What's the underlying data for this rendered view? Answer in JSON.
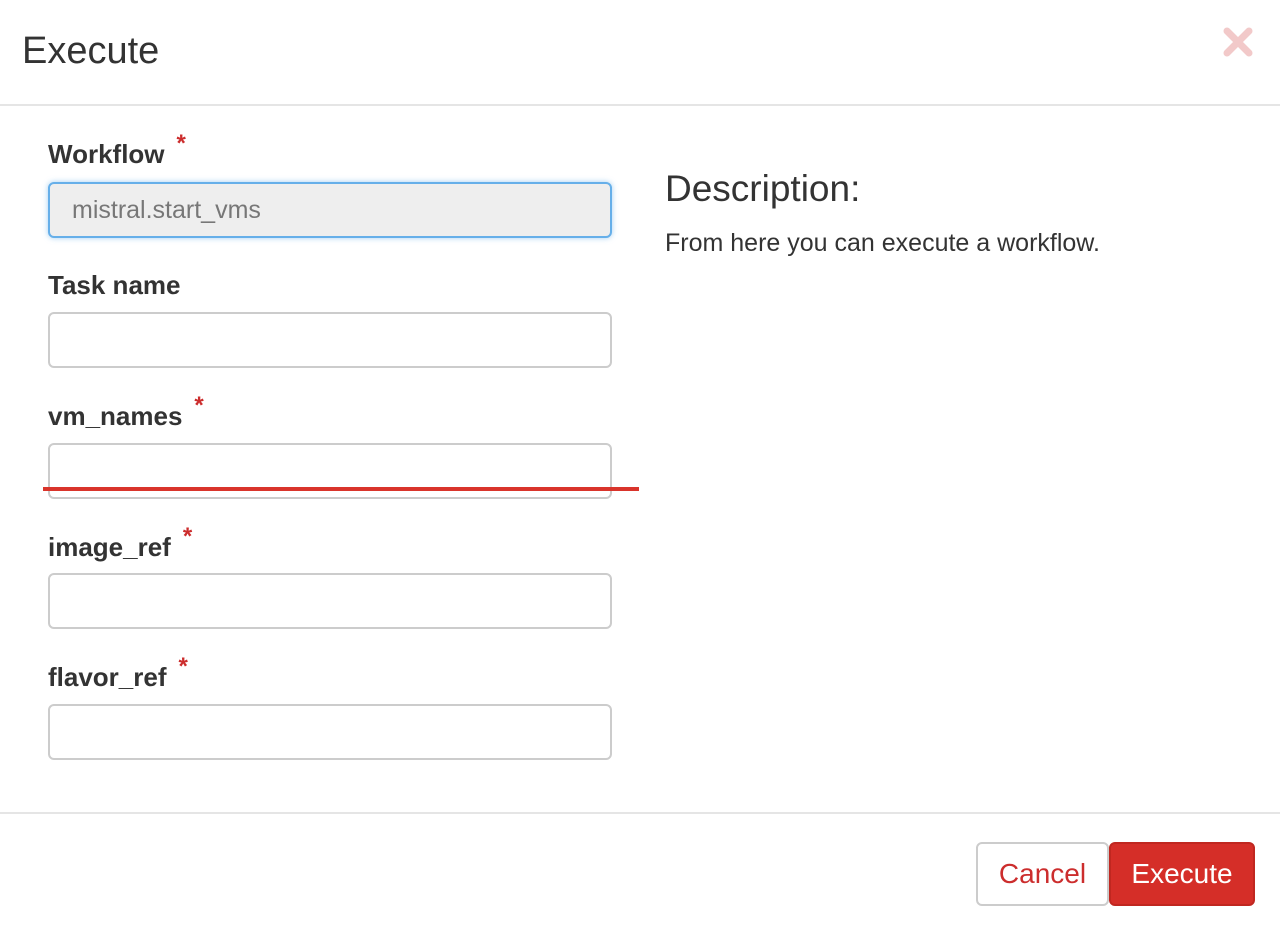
{
  "dialog": {
    "title": "Execute",
    "close_icon": "close-icon"
  },
  "form": {
    "workflow": {
      "label": "Workflow",
      "required_mark": "*",
      "value": "mistral.start_vms"
    },
    "task_name": {
      "label": "Task name",
      "value": ""
    },
    "vm_names": {
      "label": "vm_names",
      "required_mark": "*",
      "value": ""
    },
    "image_ref": {
      "label": "image_ref",
      "required_mark": "*",
      "value": ""
    },
    "flavor_ref": {
      "label": "flavor_ref",
      "required_mark": "*",
      "value": ""
    }
  },
  "description": {
    "title": "Description:",
    "text": "From here you can execute a workflow."
  },
  "footer": {
    "cancel_label": "Cancel",
    "execute_label": "Execute"
  },
  "colors": {
    "accent": "#d52e28",
    "required": "#cc2d2d",
    "focus_border": "#66afe9",
    "close_icon": "#f2c9c9"
  }
}
